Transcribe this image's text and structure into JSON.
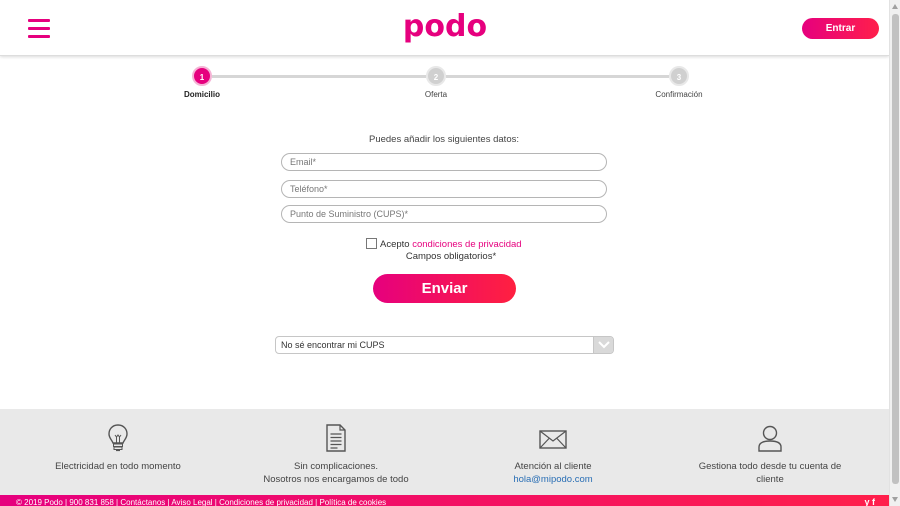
{
  "header": {
    "logo_text": "podo",
    "login_label": "Entrar"
  },
  "stepper": {
    "steps": [
      {
        "number": "1",
        "label": "Domicilio"
      },
      {
        "number": "2",
        "label": "Oferta"
      },
      {
        "number": "3",
        "label": "Confirmación"
      }
    ]
  },
  "form": {
    "intro": "Puedes añadir los siguientes datos:",
    "email_placeholder": "Email*",
    "phone_placeholder": "Teléfono*",
    "cups_placeholder": "Punto de Suministro (CUPS)*",
    "accept_text": "Acepto ",
    "privacy_link": "condiciones de privacidad",
    "required_note": "Campos obligatorios*",
    "submit_label": "Enviar"
  },
  "cups_help": {
    "selected": "No sé encontrar mi CUPS"
  },
  "features": [
    {
      "icon": "lightbulb-icon",
      "line1": "Electricidad en todo momento",
      "line2": ""
    },
    {
      "icon": "document-icon",
      "line1": "Sin complicaciones.",
      "line2": "Nosotros nos encargamos de todo"
    },
    {
      "icon": "envelope-icon",
      "line1": "Atención al cliente",
      "link": "hola@mipodo.com"
    },
    {
      "icon": "user-icon",
      "line1": "Gestiona todo desde tu cuenta de",
      "line2": "cliente"
    }
  ],
  "footer": {
    "copyright": "© 2019 Podo | 900 831 858 | Contáctanos | Aviso Legal | Condiciones de privacidad | Política de cookies",
    "social": "y f"
  },
  "colors": {
    "brand": "#e6007e",
    "brand_end": "#ff1f4b",
    "link": "#2a6fb5"
  }
}
